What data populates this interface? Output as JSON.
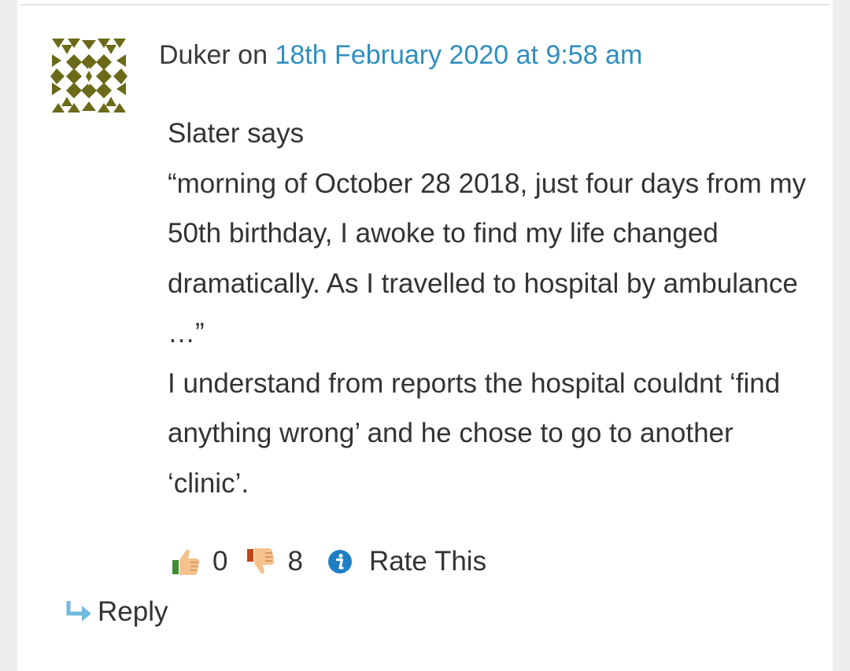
{
  "comment": {
    "author": "Duker",
    "on_text": "on",
    "date": "18th February 2020 at 9:58 am",
    "paragraphs": [
      "Slater says",
      "“morning of October 28 2018, just four days from my 50th birthday, I awoke to find my life changed dramatically. As I travelled to hospital by ambulance …”",
      "I understand from reports the hospital couldnt ‘find anything wrong’ and he chose to go to another ‘clinic’."
    ]
  },
  "rating": {
    "likes": "0",
    "dislikes": "8",
    "rate_label": "Rate This"
  },
  "reply": {
    "label": "Reply"
  },
  "colors": {
    "link": "#2f8fbf",
    "avatar": "#6b6a18",
    "reply_arrow": "#6fbbe0",
    "info_icon": "#1f7fc4"
  },
  "icons": {
    "avatar": "identicon-avatar",
    "like": "thumbs-up-icon",
    "dislike": "thumbs-down-icon",
    "info": "info-icon",
    "reply": "reply-arrow-icon"
  }
}
